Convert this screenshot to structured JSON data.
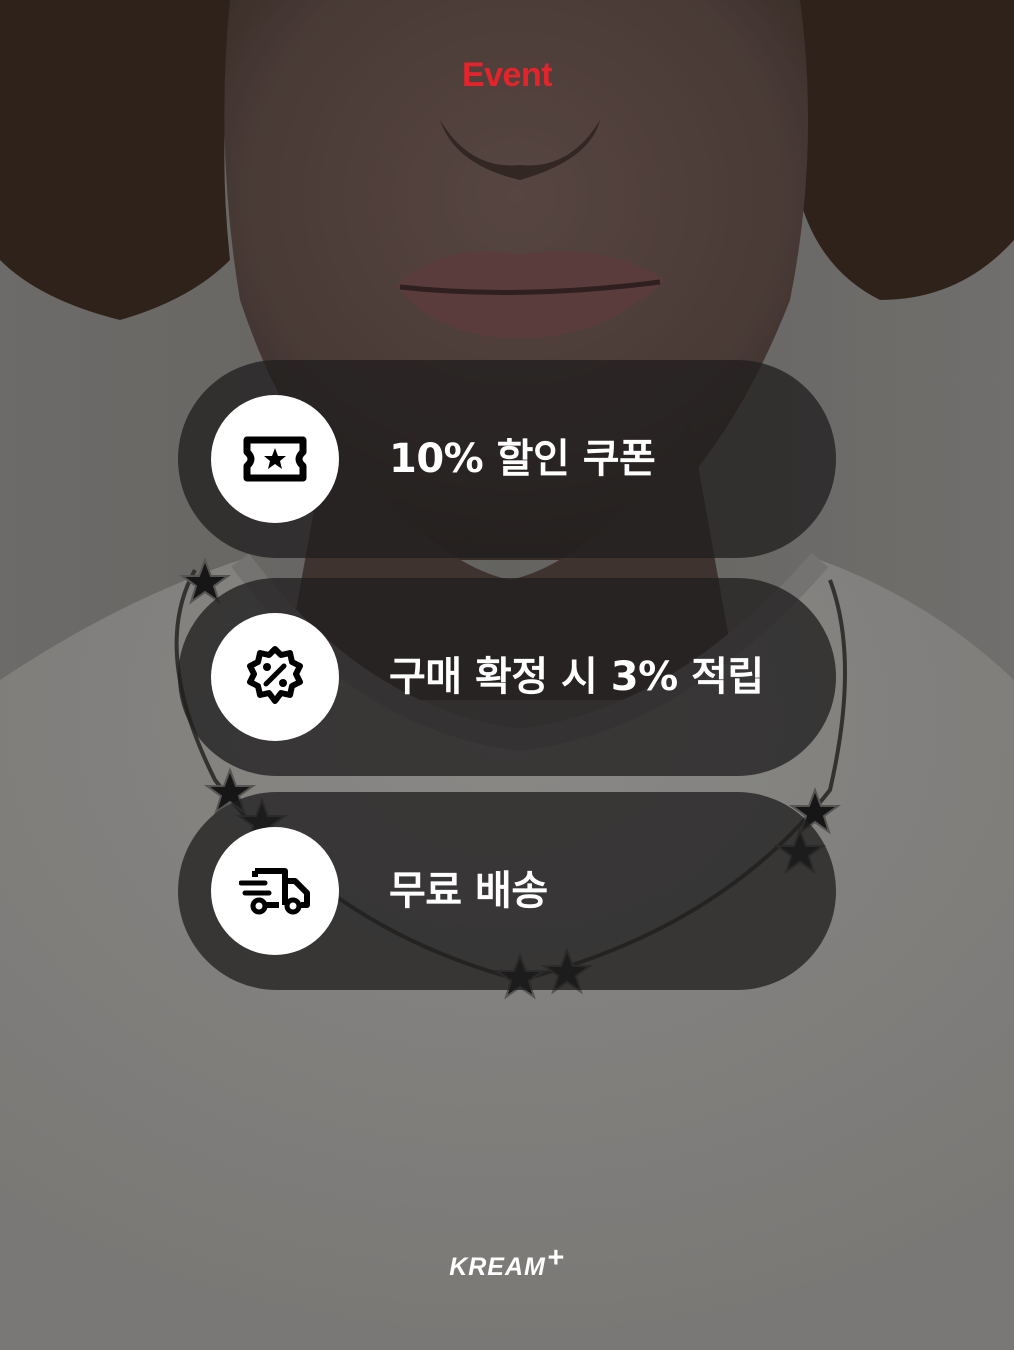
{
  "header": {
    "title": "Event"
  },
  "benefits": [
    {
      "icon": "ticket-star-icon",
      "label": "10% 할인 쿠폰"
    },
    {
      "icon": "percent-badge-icon",
      "label": "구매 확정 시 3% 적립"
    },
    {
      "icon": "fast-delivery-truck-icon",
      "label": "무료 배송"
    }
  ],
  "footer": {
    "brand": "KREAM",
    "brand_suffix": "+"
  },
  "colors": {
    "accent": "#e3242b",
    "pill_background": "#201e1e",
    "text": "#ffffff"
  }
}
